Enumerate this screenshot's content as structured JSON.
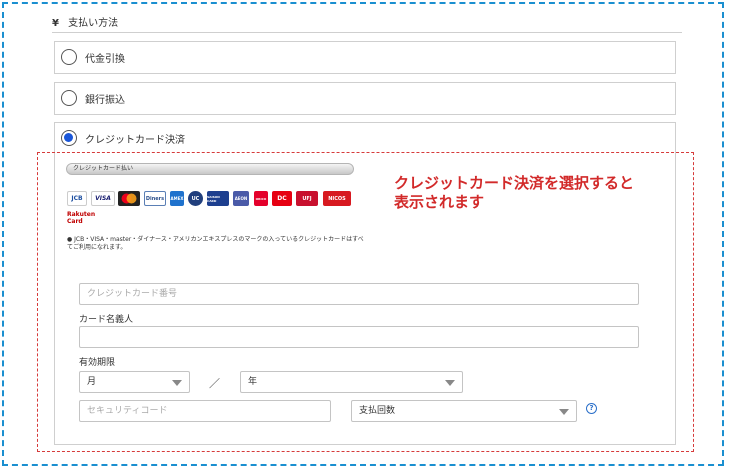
{
  "payment": {
    "section_title": "支払い方法",
    "yen_symbol": "¥",
    "options": [
      {
        "label": "代金引換",
        "selected": false
      },
      {
        "label": "銀行振込",
        "selected": false
      },
      {
        "label": "クレジットカード決済",
        "selected": true
      }
    ]
  },
  "card_form": {
    "tab_label": "クレジットカード払い",
    "brand_logos": [
      "JCB",
      "VISA",
      "mastercard",
      "Diners",
      "AMEX",
      "UC",
      "SAISON CARD",
      "AEON",
      "ORICO",
      "DC",
      "UFJ",
      "NICOS"
    ],
    "rakuten_logo": "Rakuten Card",
    "note": "● JCB・VISA・master・ダイナース・アメリカンエキスプレスのマークの入っているクレジットカードはすべてご利用になれます。",
    "card_number_placeholder": "クレジットカード番号",
    "holder_label": "カード名義人",
    "holder_value": "",
    "expiry_label": "有効期限",
    "month_value": "月",
    "year_value": "年",
    "separator": "／",
    "security_placeholder": "セキュリティコード",
    "installments_value": "支払回数",
    "help_icon_glyph": "?"
  },
  "annotation": {
    "line1": "クレジットカード決済を選択すると",
    "line2": "表示されます"
  },
  "colors": {
    "frame_border": "#1a8fd0",
    "callout": "#d22a2a",
    "radio_selected": "#1a56d8"
  }
}
